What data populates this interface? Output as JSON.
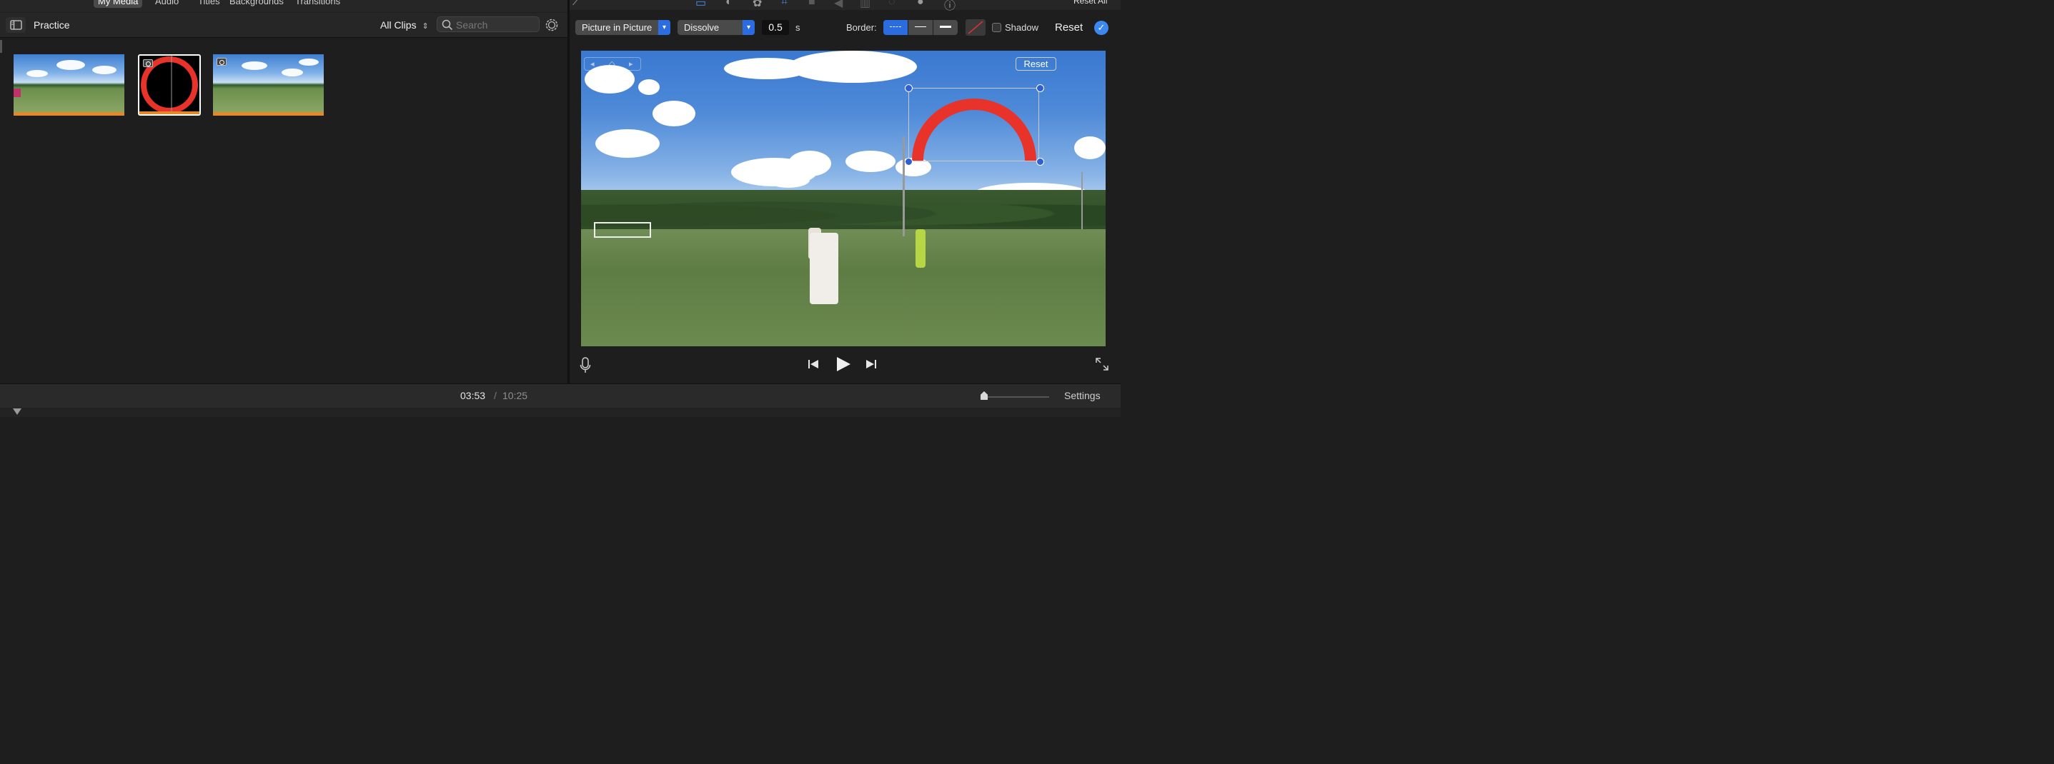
{
  "media_tabs": [
    {
      "label": "My Media",
      "active": true
    },
    {
      "label": "Audio",
      "active": false
    },
    {
      "label": "Titles",
      "active": false
    },
    {
      "label": "Backgrounds",
      "active": false
    },
    {
      "label": "Transitions",
      "active": false
    }
  ],
  "browser": {
    "library_title": "Practice",
    "clip_filter": "All Clips",
    "search_placeholder": "Search",
    "clips": [
      {
        "name": "soccer-clip-1",
        "progress_bar": true
      },
      {
        "name": "red-circle-image",
        "selected": true,
        "is_photo": true
      },
      {
        "name": "soccer-clip-2",
        "is_photo": true
      }
    ]
  },
  "viewer": {
    "toolbar_icons": [
      "magic-wand-icon",
      "video-overlay-icon",
      "color-balance-icon",
      "color-palette-icon",
      "crop-icon",
      "stabilize-icon",
      "volume-icon",
      "noise-reduction-icon",
      "speed-icon",
      "effects-icon",
      "info-icon"
    ],
    "reset_all_label": "Reset All",
    "overlay_style": "Picture in Picture",
    "transition": "Dissolve",
    "duration_value": "0.5",
    "duration_unit": "s",
    "border_label": "Border:",
    "border_options": [
      "---",
      "—",
      "▬"
    ],
    "border_active_index": 0,
    "shadow_label": "Shadow",
    "shadow_checked": false,
    "reset_label": "Reset",
    "pip_reset_label": "Reset"
  },
  "playback": {
    "current_time": "03:53",
    "separator": "/",
    "total_time": "10:25"
  },
  "bottom": {
    "settings_label": "Settings"
  },
  "colors": {
    "accent": "#2b6de0",
    "clip_bar": "#e3892a",
    "pip_red": "#e8332a"
  }
}
